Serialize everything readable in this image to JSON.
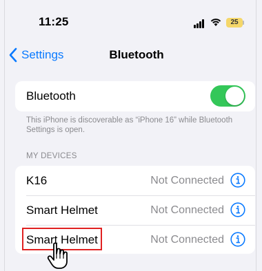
{
  "status_bar": {
    "time": "11:25",
    "battery": "25"
  },
  "nav": {
    "back_label": "Settings",
    "title": "Bluetooth"
  },
  "bluetooth": {
    "label": "Bluetooth",
    "enabled": true,
    "footnote": "This iPhone is discoverable as “iPhone 16” while Bluetooth Settings is open."
  },
  "devices": {
    "header": "MY DEVICES",
    "items": [
      {
        "name": "K16",
        "status": "Not Connected"
      },
      {
        "name": "Smart Helmet",
        "status": "Not Connected"
      },
      {
        "name": "Smart Helmet",
        "status": "Not Connected"
      }
    ]
  },
  "colors": {
    "accent": "#0a7aff",
    "toggle_on": "#34c759",
    "highlight": "#e02020",
    "battery": "#f5d76a"
  }
}
